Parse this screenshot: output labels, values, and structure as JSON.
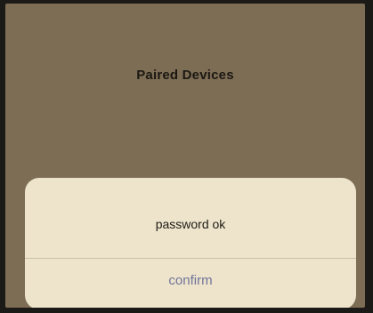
{
  "screen": {
    "title": "Paired Devices"
  },
  "alert": {
    "message": "password ok",
    "confirm_label": "confirm"
  },
  "colors": {
    "background": "#7d6d55",
    "alert_background": "#eee4cc",
    "button_text": "#6f7499"
  }
}
